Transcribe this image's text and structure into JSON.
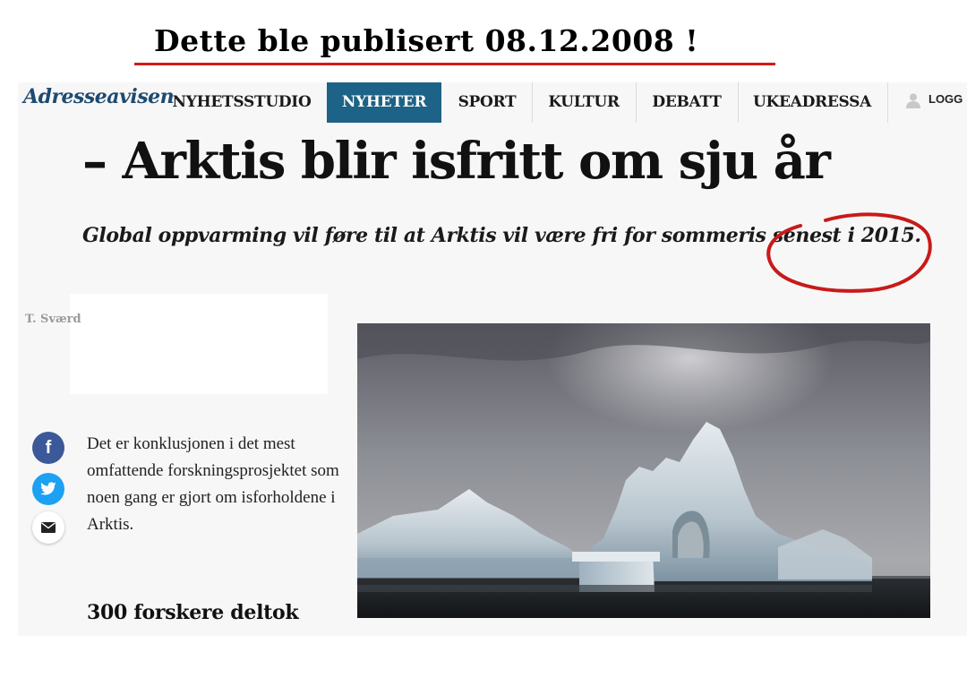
{
  "overlay": {
    "caption": "Dette ble publisert 08.12.2008 !",
    "underline_color": "#d41a1a"
  },
  "site": {
    "logo_text": "Adresseavisen",
    "brand_color": "#1f4a70"
  },
  "nav": {
    "items": [
      {
        "label": "NYHETSSTUDIO",
        "active": false
      },
      {
        "label": "NYHETER",
        "active": true
      },
      {
        "label": "SPORT",
        "active": false
      },
      {
        "label": "KULTUR",
        "active": false
      },
      {
        "label": "DEBATT",
        "active": false
      },
      {
        "label": "UKEADRESSA",
        "active": false
      }
    ],
    "active_color": "#1d6287",
    "login_label": "LOGG",
    "login_icon": "user-icon"
  },
  "article": {
    "headline": "– Arktis blir isfritt om sju år",
    "subtitle": "Global oppvarming vil føre til at Arktis vil være fri for sommeris senest i 2015.",
    "annotation_color": "#c81a1a",
    "byline": "T. Sværd",
    "lede": "Det er konklusjonen i det mest omfattende forskningsprosjektet som noen gang er gjort om isforholdene i Arktis.",
    "section_heading": "300 forskere deltok",
    "photo_subject": "iceberg-with-arch"
  },
  "share": {
    "facebook_icon": "facebook-icon",
    "facebook_glyph": "f",
    "twitter_icon": "twitter-icon",
    "mail_icon": "mail-icon",
    "facebook_color": "#3b5998",
    "twitter_color": "#1da1f2"
  }
}
